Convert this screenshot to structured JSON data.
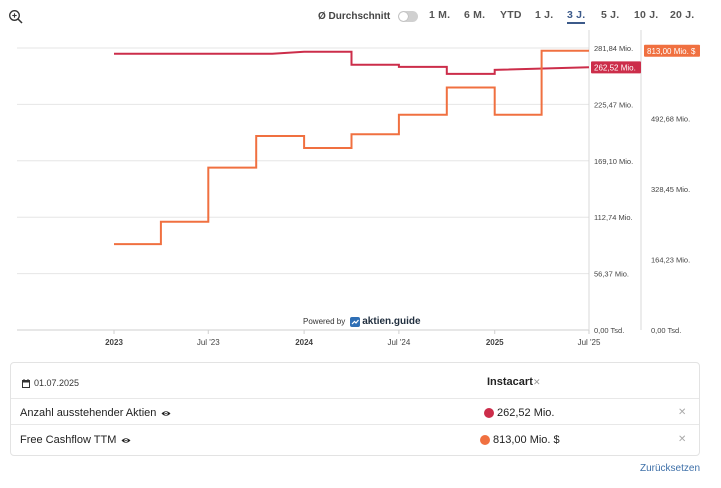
{
  "toolbar": {
    "average_label": "Ø Durchschnitt",
    "average_enabled": false,
    "ranges": [
      "1 M.",
      "6 M.",
      "YTD",
      "1 J.",
      "3 J.",
      "5 J.",
      "10 J.",
      "20 J."
    ],
    "active_range": "3 J."
  },
  "chart_data": {
    "type": "line",
    "x_ticks": [
      "2023",
      "Jul '23",
      "2024",
      "Jul '24",
      "2025",
      "Jul '25"
    ],
    "y_left": {
      "ticks": [
        "0,00 Tsd.",
        "56,37 Mio.",
        "112,74 Mio.",
        "169,10 Mio.",
        "225,47 Mio.",
        "281,84 Mio."
      ],
      "range": [
        0,
        281.84
      ],
      "unit": "Mio."
    },
    "y_right": {
      "ticks": [
        "0,00 Tsd.",
        "164,23 Mio.",
        "328,45 Mio.",
        "492,68 Mio.",
        "656,90 Mio."
      ],
      "range": [
        0,
        821.13
      ],
      "unit": "Mio."
    },
    "grid": true,
    "series": [
      {
        "name": "Anzahl ausstehender Aktien",
        "axis": "left",
        "color": "#cc2d4a",
        "last_label": "262,52 Mio.",
        "points": [
          [
            "2023-01-01",
            276.0
          ],
          [
            "2023-05-01",
            276.0
          ],
          [
            "2023-05-01",
            276.0
          ],
          [
            "2023-09-01",
            276.0
          ],
          [
            "2023-11-01",
            276.0
          ],
          [
            "2024-01-01",
            278.0
          ],
          [
            "2024-04-01",
            278.0
          ],
          [
            "2024-04-01",
            265.0
          ],
          [
            "2024-07-01",
            265.0
          ],
          [
            "2024-07-01",
            263.0
          ],
          [
            "2024-10-01",
            263.0
          ],
          [
            "2024-10-01",
            256.0
          ],
          [
            "2025-01-01",
            256.0
          ],
          [
            "2025-01-01",
            260.0
          ],
          [
            "2025-07-01",
            262.52
          ]
        ]
      },
      {
        "name": "Free Cashflow TTM",
        "axis": "right",
        "color": "#f07040",
        "last_label": "813,00 Mio. $",
        "points": [
          [
            "2023-01-01",
            250.0
          ],
          [
            "2023-04-01",
            250.0
          ],
          [
            "2023-04-01",
            315.0
          ],
          [
            "2023-07-01",
            315.0
          ],
          [
            "2023-07-01",
            473.0
          ],
          [
            "2023-10-01",
            473.0
          ],
          [
            "2023-10-01",
            565.0
          ],
          [
            "2024-01-01",
            565.0
          ],
          [
            "2024-01-01",
            530.0
          ],
          [
            "2024-04-01",
            530.0
          ],
          [
            "2024-04-01",
            570.0
          ],
          [
            "2024-07-01",
            570.0
          ],
          [
            "2024-07-01",
            627.0
          ],
          [
            "2024-10-01",
            627.0
          ],
          [
            "2024-10-01",
            706.0
          ],
          [
            "2025-01-01",
            706.0
          ],
          [
            "2025-01-01",
            627.0
          ],
          [
            "2025-04-01",
            627.0
          ],
          [
            "2025-04-01",
            813.0
          ],
          [
            "2025-07-01",
            813.0
          ]
        ]
      }
    ],
    "attribution": {
      "prefix": "Powered by",
      "brand": "aktien.guide"
    }
  },
  "table": {
    "date": "01.07.2025",
    "column_title": "Instacart",
    "rows": [
      {
        "label": "Anzahl ausstehender Aktien",
        "value": "262,52 Mio.",
        "color": "#cc2d4a"
      },
      {
        "label": "Free Cashflow TTM",
        "value": "813,00 Mio. $",
        "color": "#f07040"
      }
    ]
  },
  "reset_label": "Zurücksetzen"
}
